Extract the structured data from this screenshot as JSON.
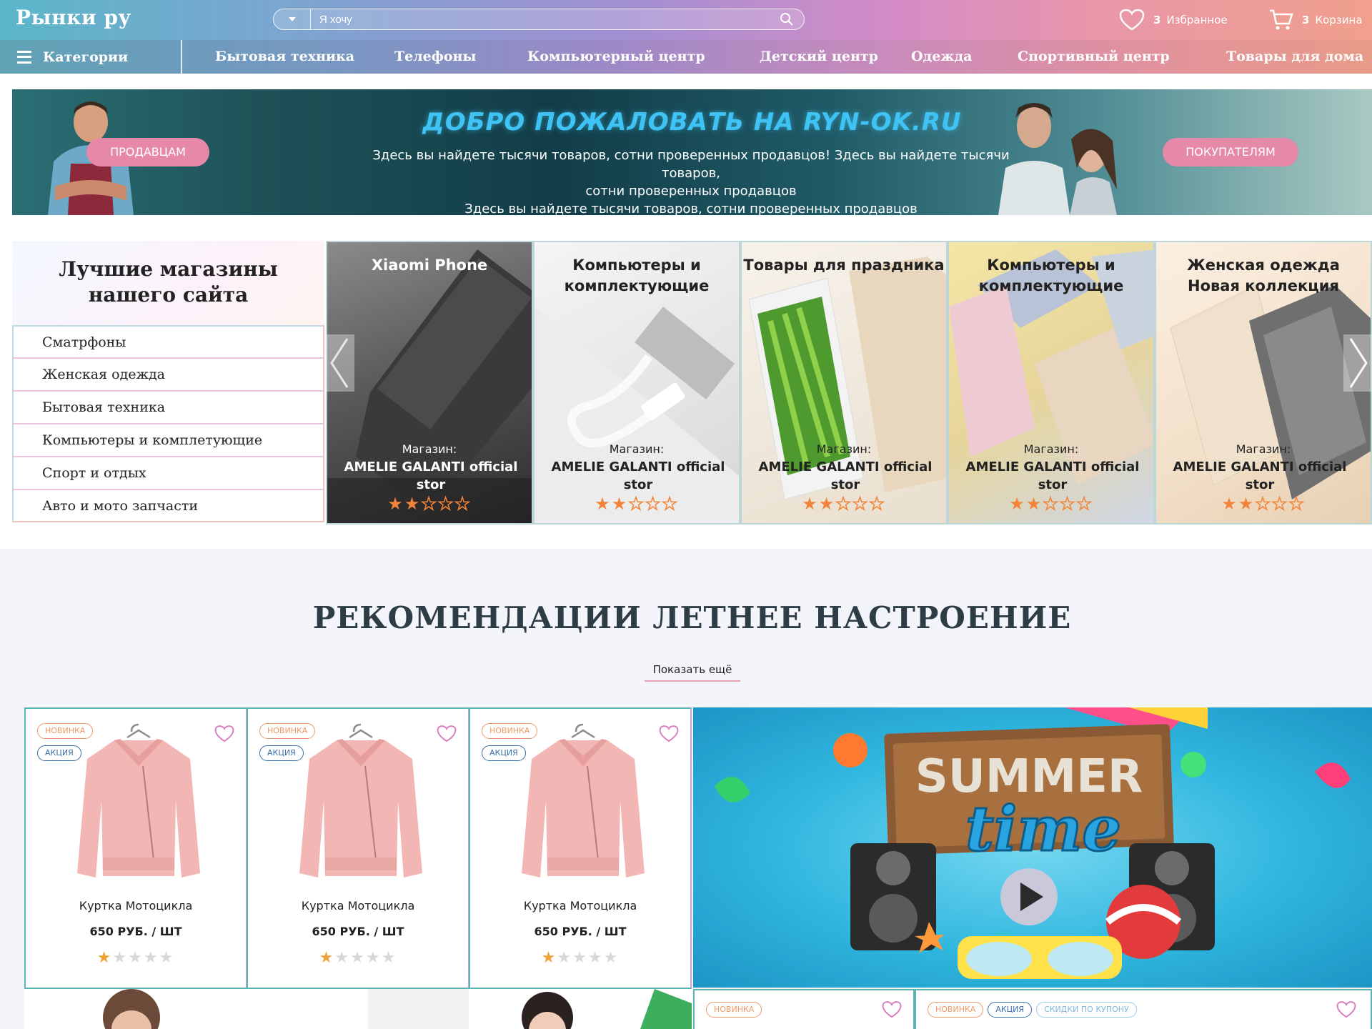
{
  "header": {
    "logo": "Рынки ру",
    "search_placeholder": "Я хочу",
    "favorites_count": "3",
    "favorites_label": "Избранное",
    "cart_count": "3",
    "cart_label": "Корзина"
  },
  "nav": {
    "categories_label": "Категории",
    "items": [
      "Бытовая техника",
      "Телефоны",
      "Компьютерный центр",
      "Детский центр",
      "Одежда",
      "Спортивный центр",
      "Товары для дома"
    ]
  },
  "banner": {
    "title": "ДОБРО ПОЖАЛОВАТЬ НА RYN-OK.RU",
    "line1": "Здесь вы найдете тысячи товаров, сотни проверенных продавцов! Здесь вы найдете тысячи товаров,",
    "line2": "сотни проверенных продавцов",
    "line3": "Здесь вы найдете тысячи товаров, сотни проверенных продавцов",
    "sellers_button": "ПРОДАВЦАМ",
    "buyers_button": "ПОКУПАТЕЛЯМ"
  },
  "shops": {
    "title_line1": "Лучшие магазины",
    "title_line2": "нашего сайта",
    "categories": [
      "Сматрфоны",
      "Женская одежда",
      "Бытовая техника",
      "Компьютеры и комплетующие",
      "Спорт и отдых",
      "Авто и мото запчасти"
    ],
    "cards": [
      {
        "title1": "Xiaomi Phone",
        "title2": "",
        "shop_label": "Магазин:",
        "shop_name1": "AMELIE GALANTI official",
        "shop_name2": "stor",
        "rating": 2
      },
      {
        "title1": "Компьютеры и",
        "title2": "комплектующие",
        "shop_label": "Магазин:",
        "shop_name1": "AMELIE GALANTI official",
        "shop_name2": "stor",
        "rating": 2
      },
      {
        "title1": "Товары для праздника",
        "title2": "",
        "shop_label": "Магазин:",
        "shop_name1": "AMELIE GALANTI official",
        "shop_name2": "stor",
        "rating": 2
      },
      {
        "title1": "Компьютеры и",
        "title2": "комплектующие",
        "shop_label": "Магазин:",
        "shop_name1": "AMELIE GALANTI official",
        "shop_name2": "stor",
        "rating": 2
      },
      {
        "title1": "Женская одежда",
        "title2": "Новая коллекция",
        "shop_label": "Магазин:",
        "shop_name1": "AMELIE GALANTI official",
        "shop_name2": "stor",
        "rating": 2
      }
    ]
  },
  "recommendations": {
    "title": "РЕКОМЕНДАЦИИ ЛЕТНЕЕ НАСТРОЕНИЕ",
    "show_more": "Показать ещё",
    "products": [
      {
        "tag_new": "НОВИНКА",
        "tag_sale": "АКЦИЯ",
        "name": "Куртка Мотоцикла",
        "price": "650 РУБ. / ШТ",
        "rating": 1
      },
      {
        "tag_new": "НОВИНКА",
        "tag_sale": "АКЦИЯ",
        "name": "Куртка Мотоцикла",
        "price": "650 РУБ. / ШТ",
        "rating": 1
      },
      {
        "tag_new": "НОВИНКА",
        "tag_sale": "АКЦИЯ",
        "name": "Куртка Мотоцикла",
        "price": "650 РУБ. / ШТ",
        "rating": 1
      }
    ],
    "promo": {
      "word1": "SUMMER",
      "word2": "time"
    },
    "row2_tags": {
      "new": "НОВИНКА",
      "sale": "АКЦИЯ",
      "coupon": "СКИДКИ ПО КУПОНУ"
    }
  },
  "colors": {
    "accent_pink": "#e688a8",
    "star_orange": "#f2843a",
    "teal_border": "#5bb5b0"
  }
}
